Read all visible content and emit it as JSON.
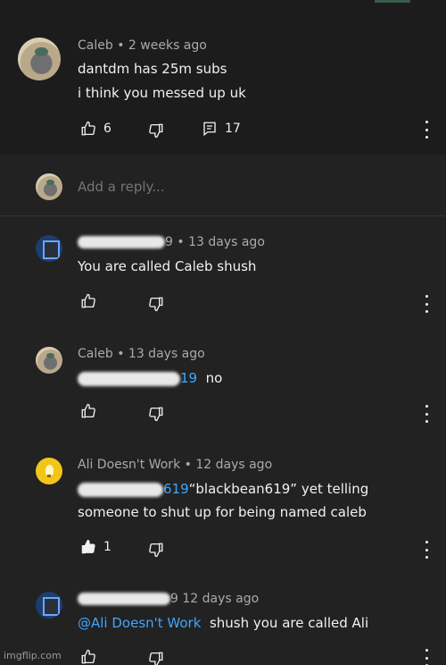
{
  "parent_comment": {
    "author": "Caleb",
    "time": "2 weeks ago",
    "lines": [
      "dantdm has 25m subs",
      "i think you messed up uk"
    ],
    "likes": "6",
    "replies": "17"
  },
  "reply_box": {
    "placeholder": "Add a reply..."
  },
  "replies": [
    {
      "author_tail": "9",
      "time": "13 days ago",
      "text": "You are called Caleb shush"
    },
    {
      "author": "Caleb",
      "time": "13 days ago",
      "mention_tail": "19",
      "text": "no"
    },
    {
      "author": "Ali Doesn't Work",
      "time": "12 days ago",
      "mention_tail": "619",
      "text_line1": "“blackbean619” yet telling",
      "text_line2": "someone to shut up for being named caleb",
      "likes": "1"
    },
    {
      "author_tail": "9",
      "time": "12 days ago",
      "mention": "@Ali Doesn't Work",
      "text": "shush you are called Ali"
    }
  ],
  "separator": "•",
  "watermark": "imgflip.com",
  "icons": [
    "like-icon",
    "dislike-icon",
    "replies-icon",
    "more-icon"
  ]
}
